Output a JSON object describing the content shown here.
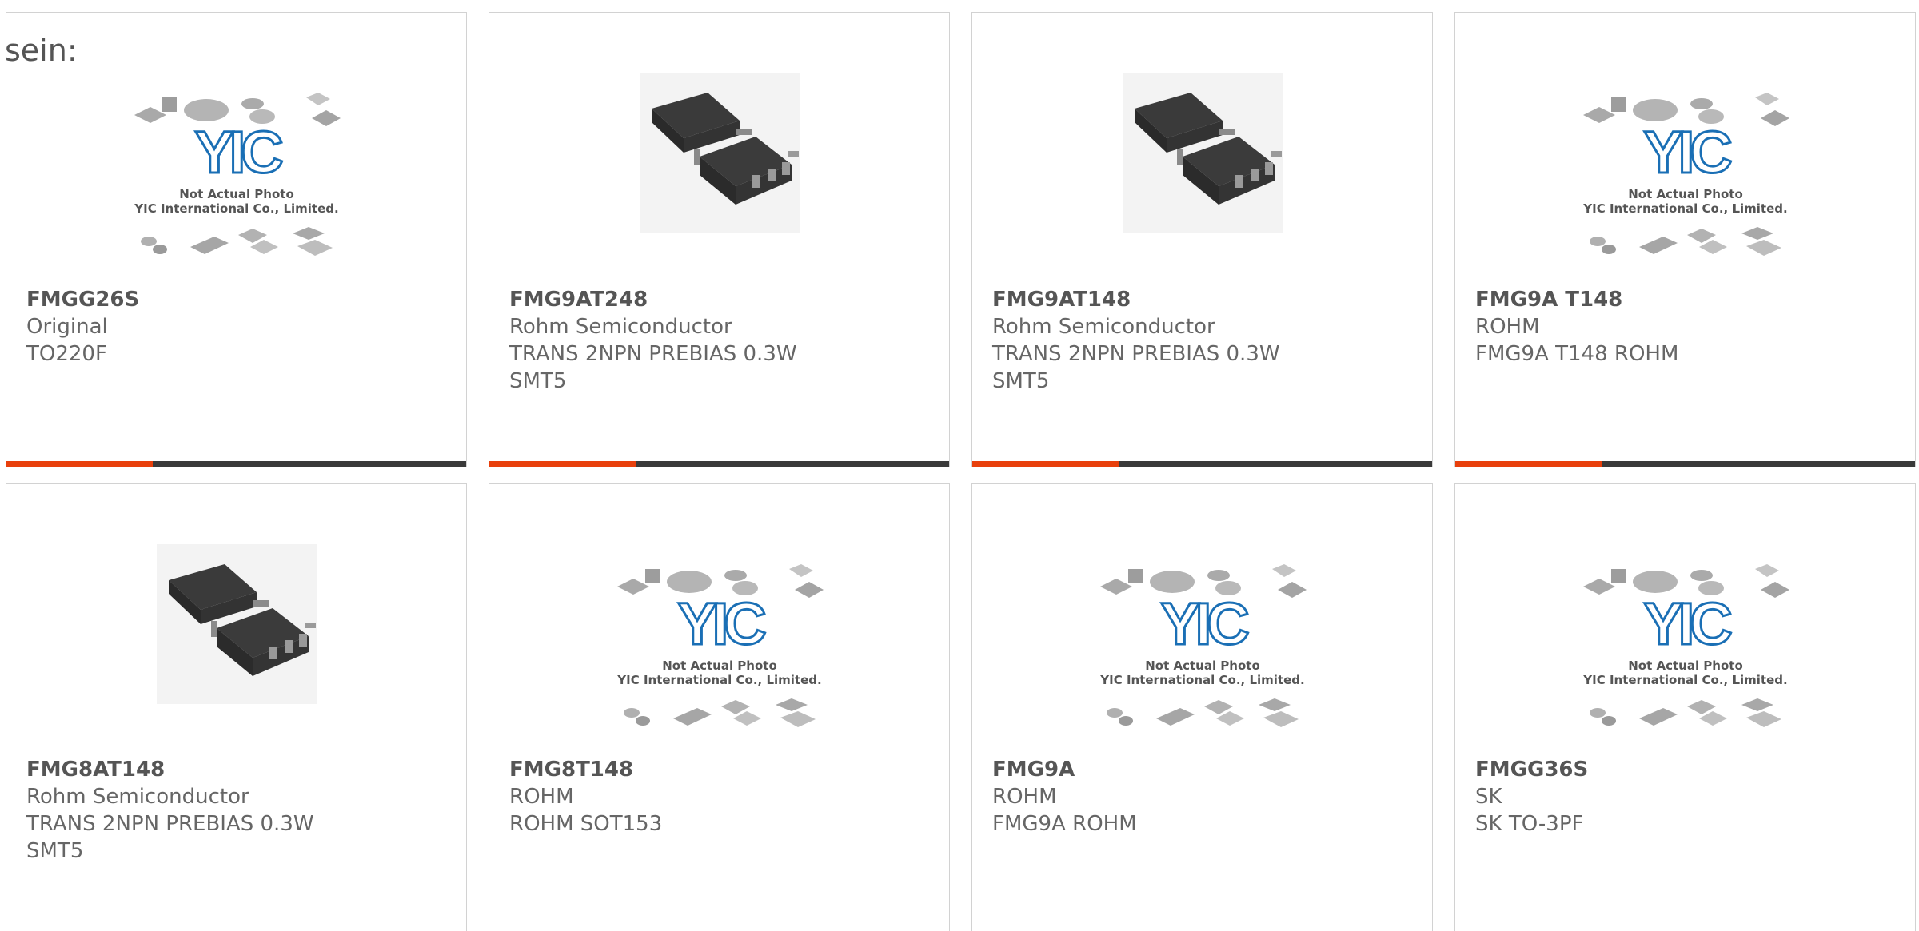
{
  "intro_text": "sein:",
  "placeholder": {
    "caption_line1": "Not Actual Photo",
    "caption_line2": "YIC International Co., Limited.",
    "logo_text": "YIC"
  },
  "products": [
    {
      "part": "FMGG26S",
      "maker": "Original",
      "desc": "TO220F",
      "pkg": "",
      "image": "placeholder"
    },
    {
      "part": "FMG9AT248",
      "maker": "Rohm Semiconductor",
      "desc": "TRANS 2NPN PREBIAS 0.3W",
      "pkg": "SMT5",
      "image": "chip"
    },
    {
      "part": "FMG9AT148",
      "maker": "Rohm Semiconductor",
      "desc": "TRANS 2NPN PREBIAS 0.3W",
      "pkg": "SMT5",
      "image": "chip"
    },
    {
      "part": "FMG9A T148",
      "maker": "ROHM",
      "desc": "FMG9A T148 ROHM",
      "pkg": "",
      "image": "placeholder"
    },
    {
      "part": "FMG8AT148",
      "maker": "Rohm Semiconductor",
      "desc": "TRANS 2NPN PREBIAS 0.3W",
      "pkg": "SMT5",
      "image": "chip"
    },
    {
      "part": "FMG8T148",
      "maker": "ROHM",
      "desc": "ROHM SOT153",
      "pkg": "",
      "image": "placeholder"
    },
    {
      "part": "FMG9A",
      "maker": "ROHM",
      "desc": "FMG9A ROHM",
      "pkg": "",
      "image": "placeholder"
    },
    {
      "part": "FMGG36S",
      "maker": "SK",
      "desc": "SK TO-3PF",
      "pkg": "",
      "image": "placeholder"
    }
  ],
  "colors": {
    "accent_orange": "#e8400c",
    "accent_dark": "#3a3a3a",
    "logo_blue": "#1a6fb5"
  }
}
